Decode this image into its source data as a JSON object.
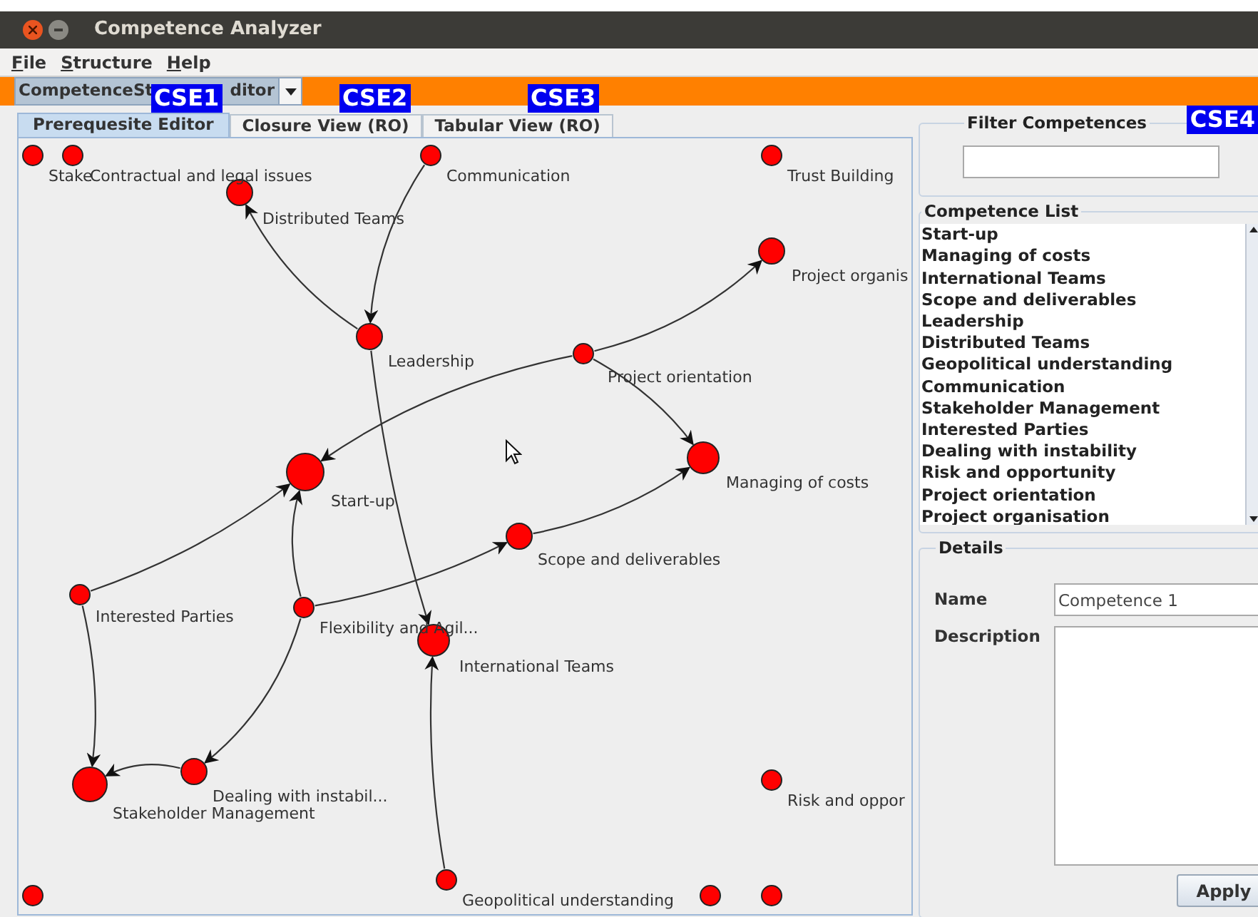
{
  "window": {
    "title": "Competence Analyzer"
  },
  "menu": [
    "File",
    "Structure",
    "Help"
  ],
  "editor_selector": {
    "visible_parts": [
      "CompetenceSt",
      "ditor"
    ]
  },
  "tabs": [
    {
      "label": "Prerequesite Editor",
      "selected": true
    },
    {
      "label": "Closure View (RO)",
      "selected": false
    },
    {
      "label": "Tabular View (RO)",
      "selected": false
    }
  ],
  "annotations": [
    {
      "text": "CSE1"
    },
    {
      "text": "CSE2"
    },
    {
      "text": "CSE3"
    },
    {
      "text": "CSE4"
    }
  ],
  "graph": {
    "nodes": [
      {
        "kind": "labeled",
        "label": "Stake"
      },
      {
        "kind": "labeled",
        "label": "Contractual and legal issues"
      },
      {
        "kind": "labeled",
        "label": "Communication"
      },
      {
        "kind": "labeled",
        "label": "Trust Building"
      },
      {
        "kind": "labeled",
        "label": "Distributed Teams"
      },
      {
        "kind": "labeled",
        "label": "Project organis"
      },
      {
        "kind": "labeled",
        "label": "Leadership"
      },
      {
        "kind": "labeled",
        "label": "Project orientation"
      },
      {
        "kind": "labeled",
        "label": "Start-up"
      },
      {
        "kind": "labeled",
        "label": "Managing of costs"
      },
      {
        "kind": "labeled",
        "label": "Scope and deliverables"
      },
      {
        "kind": "labeled",
        "label": "Interested Parties"
      },
      {
        "kind": "labeled",
        "label": "Flexibility and Agil..."
      },
      {
        "kind": "labeled",
        "label": "International Teams"
      },
      {
        "kind": "labeled",
        "label": "Dealing with instabil..."
      },
      {
        "kind": "labeled",
        "label": "Stakeholder Management"
      },
      {
        "kind": "labeled",
        "label": "Risk and oppor"
      },
      {
        "kind": "labeled",
        "label": "Geopolitical understanding"
      },
      {
        "kind": "dot"
      },
      {
        "kind": "dot"
      },
      {
        "kind": "dot"
      }
    ]
  },
  "filter": {
    "title": "Filter Competences"
  },
  "competence_list": {
    "title": "Competence List",
    "items": [
      "Start-up",
      "Managing of costs",
      "International Teams",
      "Scope and deliverables",
      "Leadership",
      "Distributed Teams",
      "Geopolitical understanding",
      "Communication",
      "Stakeholder Management",
      "Interested Parties",
      "Dealing with instability",
      "Risk and opportunity",
      "Project orientation",
      "Project organisation"
    ]
  },
  "details": {
    "title": "Details",
    "name_label": "Name",
    "name_value": "Competence 1",
    "description_label": "Description",
    "apply": "Apply"
  }
}
